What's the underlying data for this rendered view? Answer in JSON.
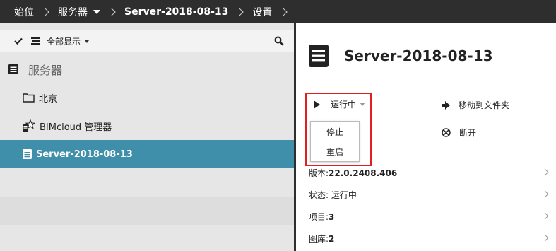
{
  "breadcrumb": {
    "items": [
      "始位",
      "服务器",
      "Server-2018-08-13",
      "设置"
    ]
  },
  "left_panel": {
    "toolbar": {
      "show_all_label": "全部显示"
    },
    "section_title": "服务器",
    "tree": [
      {
        "label": "北京",
        "icon": "folder-icon"
      },
      {
        "label": "BIMcloud 管理器",
        "icon": "manager-icon"
      },
      {
        "label": "Server-2018-08-13",
        "icon": "server-icon",
        "selected": true
      }
    ]
  },
  "right_panel": {
    "title": "Server-2018-08-13",
    "status_label": "运行中",
    "status_menu": [
      "停止",
      "重启"
    ],
    "actions": [
      {
        "label": "移动到文件夹",
        "icon": "arrow-right-icon"
      },
      {
        "label": "断开",
        "icon": "disconnect-icon"
      }
    ],
    "properties": [
      {
        "key": "版本: ",
        "value": "22.0.2408.406"
      },
      {
        "key": "状态: 运行中",
        "value": ""
      },
      {
        "key": "项目: ",
        "value": "3"
      },
      {
        "key": "图库: ",
        "value": "2"
      }
    ]
  },
  "colors": {
    "topbar_bg": "#2e2e2e",
    "selected_row_bg": "#3f8eaa",
    "highlight_border": "#e02020",
    "left_panel_bg": "#e6e6e6"
  }
}
